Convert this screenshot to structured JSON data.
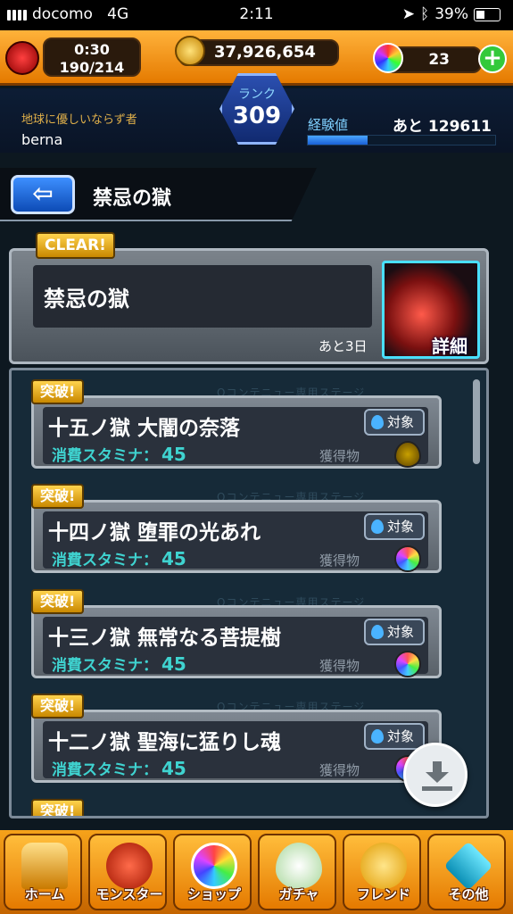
{
  "status_bar": {
    "carrier": "docomo",
    "network": "4G",
    "time": "2:11",
    "battery": "39%",
    "battery_fraction": 0.39
  },
  "hud": {
    "stamina_timer": "0:30",
    "stamina": "190/214",
    "gold": "37,926,654",
    "orbs": "23",
    "plus_label": "+"
  },
  "player": {
    "title": "地球に優しいならず者",
    "name": "berna",
    "rank_label": "ランク",
    "rank": "309",
    "exp_label": "経験値",
    "exp_remaining": "あと 129611"
  },
  "header": {
    "back_icon": "back-arrow-icon",
    "title": "禁忌の獄"
  },
  "event": {
    "badge": "CLEAR!",
    "name": "禁忌の獄",
    "remaining": "あと3日",
    "details_label": "詳細"
  },
  "stages": [
    {
      "badge": "突破!",
      "name": "十五ノ獄 大闇の奈落",
      "stamina_label": "消費スタミナ：",
      "stamina": "45",
      "target_label": "対象",
      "reward_label": "獲得物",
      "reward_icon": "gold-egg-icon"
    },
    {
      "badge": "突破!",
      "name": "十四ノ獄 堕罪の光あれ",
      "stamina_label": "消費スタミナ：",
      "stamina": "45",
      "target_label": "対象",
      "reward_label": "獲得物",
      "reward_icon": "rainbow-egg-icon"
    },
    {
      "badge": "突破!",
      "name": "十三ノ獄 無常なる菩提樹",
      "stamina_label": "消費スタミナ：",
      "stamina": "45",
      "target_label": "対象",
      "reward_label": "獲得物",
      "reward_icon": "rainbow-egg-icon"
    },
    {
      "badge": "突破!",
      "name": "十二ノ獄 聖海に猛りし魂",
      "stamina_label": "消費スタミナ：",
      "stamina": "45",
      "target_label": "対象",
      "reward_label": "獲得物",
      "reward_icon": "rainbow-egg-icon"
    }
  ],
  "next_badge": "突破!",
  "bg_stripe_text": "Oコンテニュー専用ステージ",
  "nav": [
    {
      "label": "ホーム",
      "icon": "home-icon"
    },
    {
      "label": "モンスター",
      "icon": "monster-icon"
    },
    {
      "label": "ショップ",
      "icon": "orb-shop-icon"
    },
    {
      "label": "ガチャ",
      "icon": "egg-gacha-icon"
    },
    {
      "label": "フレンド",
      "icon": "friend-balloon-icon"
    },
    {
      "label": "その他",
      "icon": "other-diamond-icon"
    }
  ],
  "colors": {
    "hud_orange": "#e57a00",
    "stamina_cyan": "#3fd3d0",
    "badge_gold": "#ffd34d",
    "rank_blue": "#2b4fb0"
  }
}
